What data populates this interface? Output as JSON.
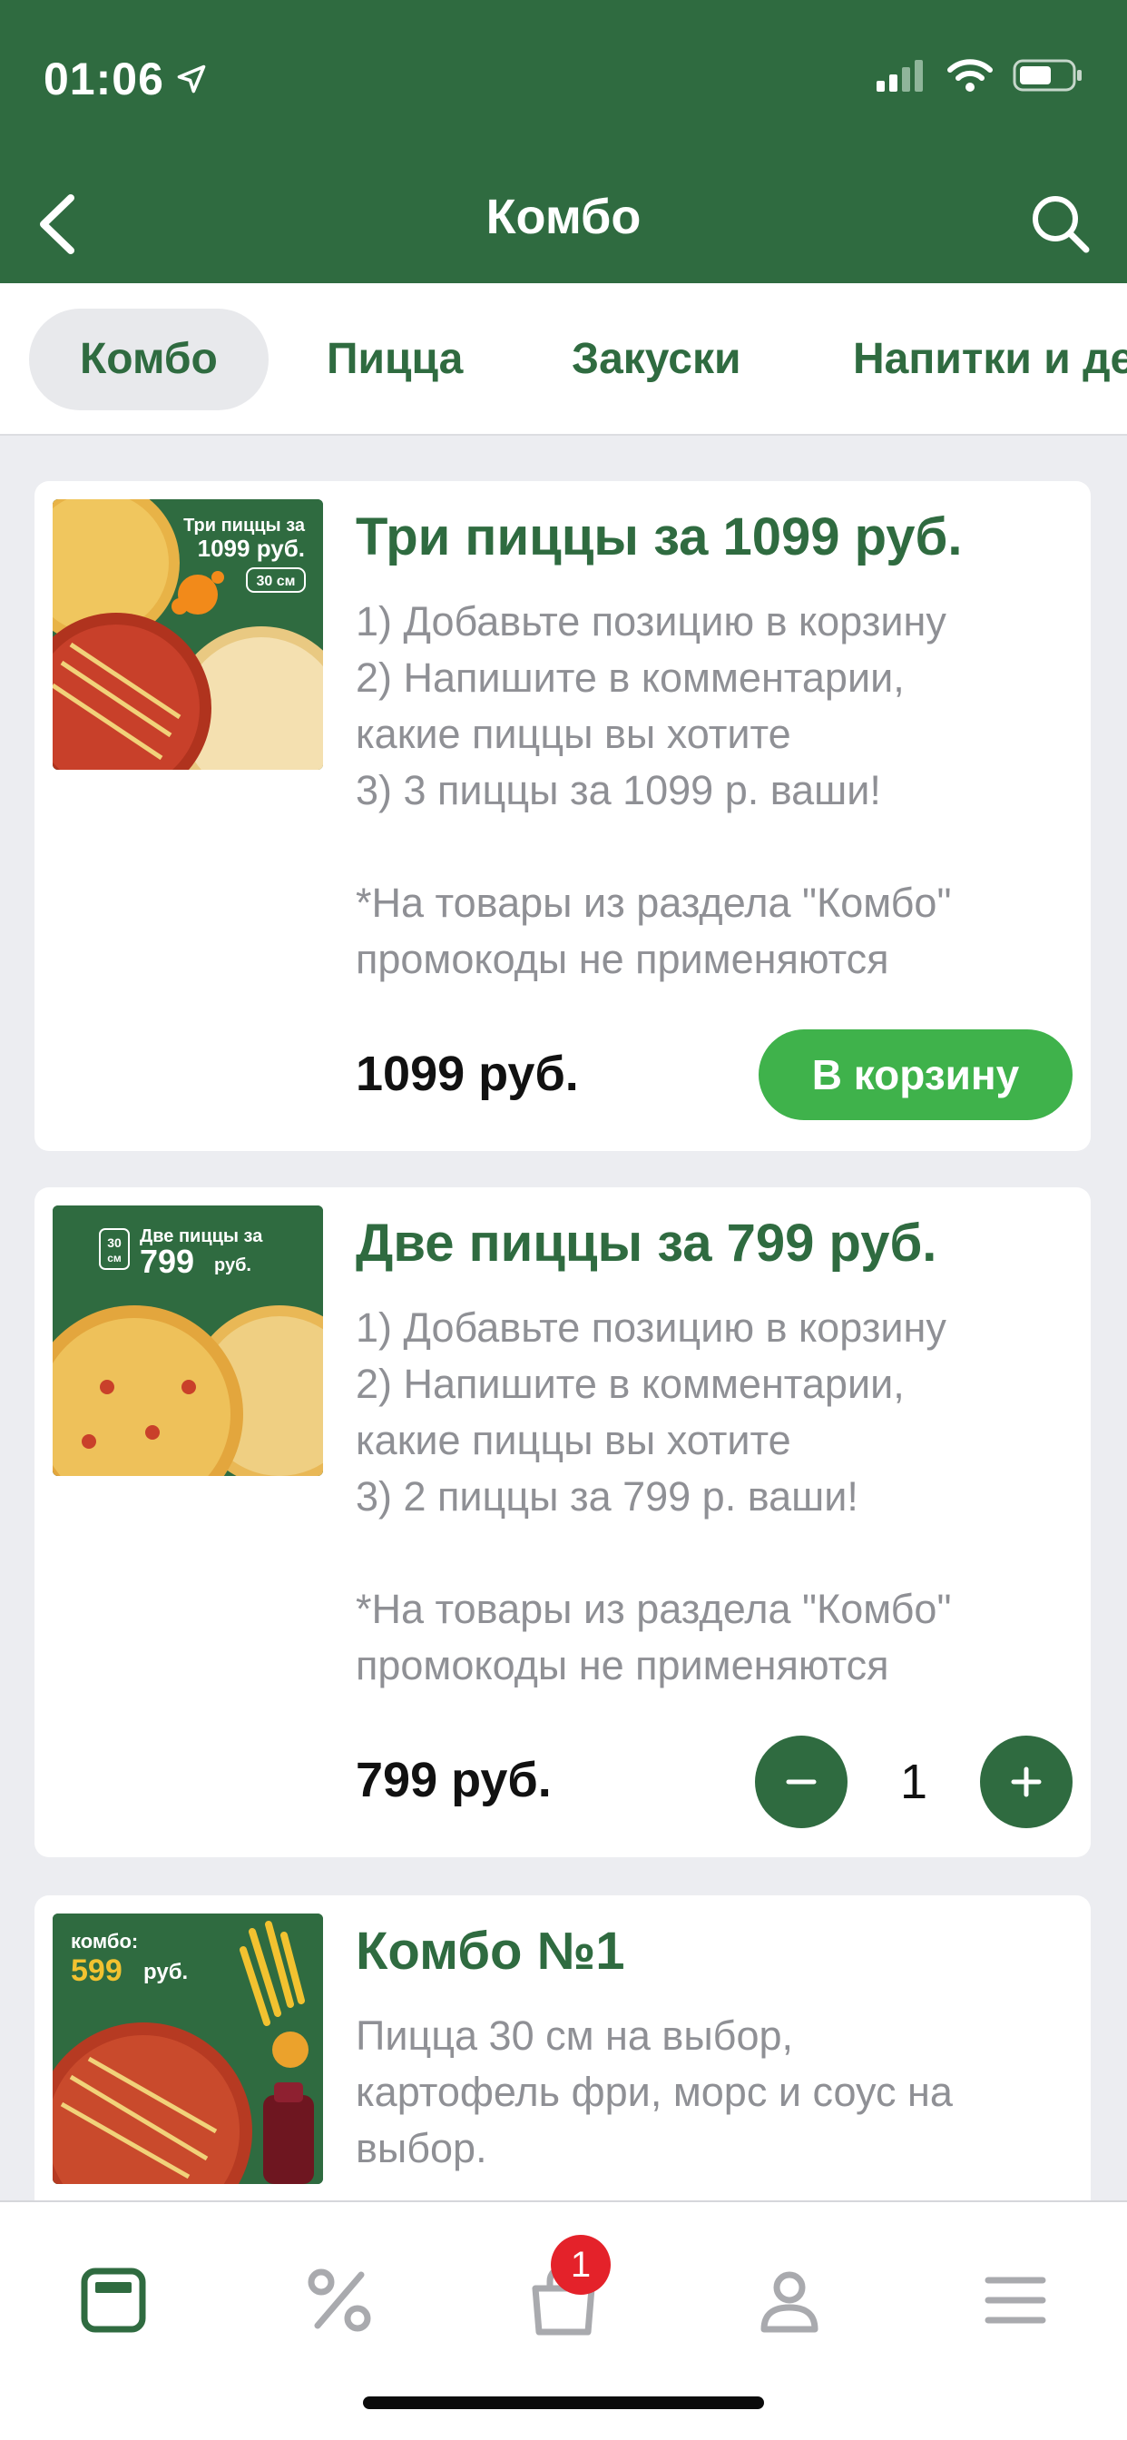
{
  "status": {
    "time": "01:06"
  },
  "nav": {
    "title": "Комбо"
  },
  "tabs": [
    {
      "label": "Комбо",
      "active": true
    },
    {
      "label": "Пицца",
      "active": false
    },
    {
      "label": "Закуски",
      "active": false
    },
    {
      "label": "Напитки и десерты",
      "active": false
    }
  ],
  "products": [
    {
      "title": "Три пиццы за 1099 руб.",
      "desc": [
        "1) Добавьте позицию в корзину",
        "2) Напишите в комментарии,",
        "какие пиццы вы хотите",
        "3) 3 пиццы за 1099 р. ваши!",
        "",
        "*На товары из раздела \"Комбо\"",
        "промокоды не применяются"
      ],
      "price": "1099 руб.",
      "button": "В корзину",
      "image_text": {
        "line1": "Три пиццы за",
        "line2": "1099 руб.",
        "size": "30 см"
      }
    },
    {
      "title": "Две пиццы за 799 руб.",
      "desc": [
        "1) Добавьте позицию в корзину",
        "2) Напишите в комментарии,",
        "какие пиццы вы хотите",
        "3) 2 пиццы за 799 р. ваши!",
        "",
        "*На товары из раздела \"Комбо\"",
        "промокоды не применяются"
      ],
      "price": "799 руб.",
      "quantity": "1",
      "image_text": {
        "size_num": "30",
        "size_unit": "см",
        "line1": "Две пиццы за",
        "line2": "799",
        "line2b": "руб."
      }
    },
    {
      "title": "Комбо №1",
      "desc": [
        "Пицца 30 см на выбор,",
        "картофель фри, морс и соус на",
        "выбор."
      ],
      "image_text": {
        "line1": "комбо:",
        "line2": "599",
        "line2b": "руб."
      }
    }
  ],
  "tabbar": {
    "items": [
      "menu-icon",
      "percent-icon",
      "bag-icon",
      "profile-icon",
      "hamburger-icon"
    ],
    "cart_badge": "1"
  },
  "colors": {
    "brand": "#2f6b40",
    "accent": "#3fb24b",
    "badge": "#e4222a"
  }
}
